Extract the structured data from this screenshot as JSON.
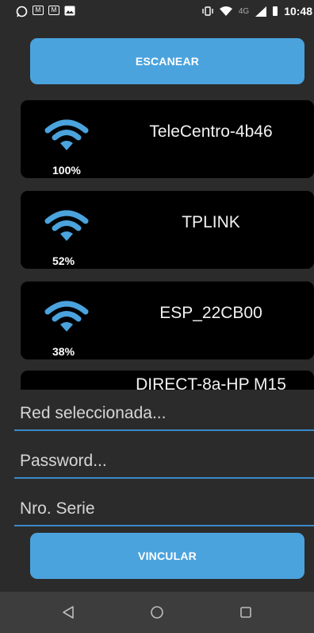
{
  "status_bar": {
    "time": "10:48",
    "network_type": "4G",
    "icons": [
      "whatsapp-icon",
      "gmail-icon",
      "gmail-icon",
      "image-icon",
      "vibrate-icon",
      "wifi-icon",
      "signal-icon",
      "battery-icon"
    ]
  },
  "scan_button": {
    "label": "ESCANEAR"
  },
  "networks": [
    {
      "ssid": "TeleCentro-4b46",
      "signal": "100%"
    },
    {
      "ssid": "TPLINK",
      "signal": "52%"
    },
    {
      "ssid": "ESP_22CB00",
      "signal": "38%"
    },
    {
      "ssid": "DIRECT-8a-HP M15",
      "signal": ""
    }
  ],
  "form": {
    "selected_network": {
      "placeholder": "Red seleccionada...",
      "value": ""
    },
    "password": {
      "placeholder": "Password...",
      "value": ""
    },
    "serial": {
      "placeholder": "Nro. Serie",
      "value": ""
    }
  },
  "link_button": {
    "label": "VINCULAR"
  },
  "nav_bar": {
    "icons": [
      "back-icon",
      "home-icon",
      "recents-icon"
    ]
  },
  "colors": {
    "accent": "#4ba3dd",
    "background": "#2b2b2b",
    "card": "#000000",
    "underline": "#3c8ac9"
  }
}
